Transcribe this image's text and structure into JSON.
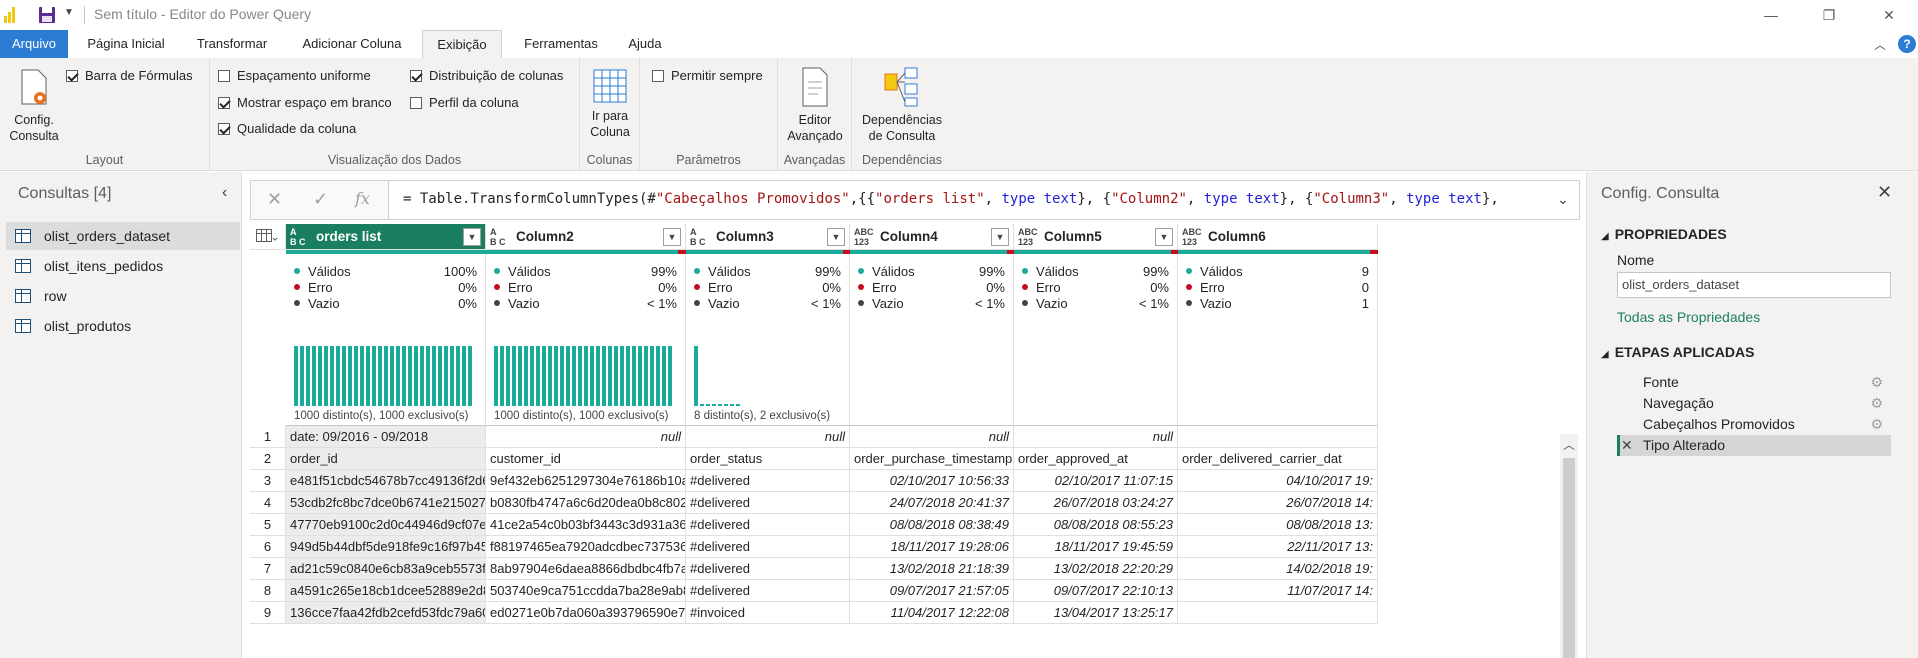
{
  "window": {
    "title": "Sem título - Editor do Power Query",
    "minimize_glyph": "—",
    "restore_glyph": "❐",
    "close_glyph": "✕"
  },
  "tabs": [
    "Arquivo",
    "Página Inicial",
    "Transformar",
    "Adicionar Coluna",
    "Exibição",
    "Ferramentas",
    "Ajuda"
  ],
  "ribbon": {
    "layout": {
      "config_label_1": "Config.",
      "config_label_2": "Consulta",
      "formula_bar": {
        "label": "Barra de Fórmulas",
        "checked": true
      },
      "group_label": "Layout"
    },
    "data_view": {
      "uniform_spacing": {
        "label": "Espaçamento uniforme",
        "checked": false
      },
      "show_whitespace": {
        "label": "Mostrar espaço em branco",
        "checked": true
      },
      "column_quality": {
        "label": "Qualidade da coluna",
        "checked": true
      },
      "column_distribution": {
        "label": "Distribuição de colunas",
        "checked": true
      },
      "column_profile": {
        "label": "Perfil da coluna",
        "checked": false
      },
      "group_label": "Visualização dos Dados"
    },
    "columns": {
      "btn_1": "Ir para",
      "btn_2": "Coluna",
      "group_label": "Colunas"
    },
    "parameters": {
      "always_allow": {
        "label": "Permitir sempre",
        "checked": false
      },
      "group_label": "Parâmetros"
    },
    "advanced": {
      "btn_1": "Editor",
      "btn_2": "Avançado",
      "group_label": "Avançadas"
    },
    "dependencies": {
      "btn_1": "Dependências",
      "btn_2": "de Consulta",
      "group_label": "Dependências"
    }
  },
  "queries": {
    "title": "Consultas [4]",
    "items": [
      "olist_orders_dataset",
      "olist_itens_pedidos",
      "row",
      "olist_produtos"
    ],
    "selected_index": 0
  },
  "formula_bar": {
    "cancel_glyph": "✕",
    "confirm_glyph": "✓",
    "fx_glyph": "fx",
    "p1": "= Table.TransformColumnTypes(#",
    "s1": "\"Cabeçalhos Promovidos\"",
    "p2": ",{{",
    "s2": "\"orders list\"",
    "p3": ", ",
    "k1": "type text",
    "p4": "}, {",
    "s3": "\"Column2\"",
    "p5": ", ",
    "k2": "type text",
    "p6": "}, {",
    "s4": "\"Column3\"",
    "p7": ", ",
    "k3": "type text",
    "p8": "},"
  },
  "grid": {
    "columns": [
      {
        "type_line1": "A",
        "type_line2": "B C",
        "name": "orders list",
        "selected": true,
        "valid": "100%",
        "error": "0%",
        "empty": "0%",
        "footer": "1000 distinto(s), 1000 exclusivo(s)",
        "red_fraction": 0
      },
      {
        "type_line1": "A",
        "type_line2": "B C",
        "name": "Column2",
        "selected": false,
        "valid": "99%",
        "error": "0%",
        "empty": "< 1%",
        "footer": "1000 distinto(s), 1000 exclusivo(s)",
        "red_fraction": 0.01
      },
      {
        "type_line1": "A",
        "type_line2": "B C",
        "name": "Column3",
        "selected": false,
        "valid": "99%",
        "error": "0%",
        "empty": "< 1%",
        "footer": "8 distinto(s), 2 exclusivo(s)",
        "red_fraction": 0.01
      },
      {
        "type_line1": "ABC",
        "type_line2": "123",
        "name": "Column4",
        "selected": false,
        "valid": "99%",
        "error": "0%",
        "empty": "< 1%",
        "footer": "",
        "red_fraction": 0.01
      },
      {
        "type_line1": "ABC",
        "type_line2": "123",
        "name": "Column5",
        "selected": false,
        "valid": "99%",
        "error": "0%",
        "empty": "< 1%",
        "footer": "",
        "red_fraction": 0.01
      },
      {
        "type_line1": "ABC",
        "type_line2": "123",
        "name": "Column6",
        "selected": false,
        "valid": "9",
        "error": "0",
        "empty": "1",
        "footer": "",
        "red_fraction": 0.01
      }
    ],
    "stat_labels": {
      "valid": "Válidos",
      "error": "Erro",
      "empty": "Vazio"
    },
    "rows": [
      {
        "n": "1",
        "cells": [
          "date: 09/2016 - 09/2018",
          "null",
          "null",
          "null",
          "null",
          ""
        ]
      },
      {
        "n": "2",
        "cells": [
          "order_id",
          "customer_id",
          "order_status",
          "order_purchase_timestamp",
          "order_approved_at",
          "order_delivered_carrier_dat"
        ]
      },
      {
        "n": "3",
        "cells": [
          "e481f51cbdc54678b7cc49136f2d6af7",
          "9ef432eb6251297304e76186b10a9...",
          "#delivered",
          "02/10/2017 10:56:33",
          "02/10/2017 11:07:15",
          "04/10/2017 19:"
        ]
      },
      {
        "n": "4",
        "cells": [
          "53cdb2fc8bc7dce0b6741e21502734...",
          "b0830fb4747a6c6d20dea0b8c802d7...",
          "#delivered",
          "24/07/2018 20:41:37",
          "26/07/2018 03:24:27",
          "26/07/2018 14:"
        ]
      },
      {
        "n": "5",
        "cells": [
          "47770eb9100c2d0c44946d9cf07ec6...",
          "41ce2a54c0b03bf3443c3d931a3670...",
          "#delivered",
          "08/08/2018 08:38:49",
          "08/08/2018 08:55:23",
          "08/08/2018 13:"
        ]
      },
      {
        "n": "6",
        "cells": [
          "949d5b44dbf5de918fe9c16f97b45f8a",
          "f88197465ea7920adcdbec7375364d...",
          "#delivered",
          "18/11/2017 19:28:06",
          "18/11/2017 19:45:59",
          "22/11/2017 13:"
        ]
      },
      {
        "n": "7",
        "cells": [
          "ad21c59c0840e6cb83a9ceb5573f8159",
          "8ab97904e6daea8866dbdbc4fb7aad...",
          "#delivered",
          "13/02/2018 21:18:39",
          "13/02/2018 22:20:29",
          "14/02/2018 19:"
        ]
      },
      {
        "n": "8",
        "cells": [
          "a4591c265e18cb1dcee52889e2d8ac...",
          "503740e9ca751ccdda7ba28e9ab8f6...",
          "#delivered",
          "09/07/2017 21:57:05",
          "09/07/2017 22:10:13",
          "11/07/2017 14:"
        ]
      },
      {
        "n": "9",
        "cells": [
          "136cce7faa42fdb2cefd53fdc79a6098",
          "ed0271e0b7da060a393796590e7b7...",
          "#invoiced",
          "11/04/2017 12:22:08",
          "13/04/2017 13:25:17",
          ""
        ]
      }
    ]
  },
  "settings": {
    "title": "Config. Consulta",
    "close_glyph": "✕",
    "properties_heading": "PROPRIEDADES",
    "name_label": "Nome",
    "name_value": "olist_orders_dataset",
    "all_properties_link": "Todas as Propriedades",
    "steps_heading": "ETAPAS APLICADAS",
    "steps": [
      {
        "label": "Fonte",
        "gear": true
      },
      {
        "label": "Navegação",
        "gear": true
      },
      {
        "label": "Cabeçalhos Promovidos",
        "gear": true
      },
      {
        "label": "Tipo Alterado",
        "gear": false,
        "selected": true
      }
    ]
  },
  "colors": {
    "accent": "#1a7f60",
    "file_tab": "#2b7cd3",
    "quality_valid": "#1aab9b",
    "quality_error": "#c50f1f",
    "dot_empty": "#444444"
  },
  "icons": {
    "app": "powerbi-logo-icon",
    "save": "save-icon",
    "config": "query-settings-icon",
    "goto_column": "go-to-column-icon",
    "advanced_editor": "advanced-editor-icon",
    "dependencies": "query-dependencies-icon",
    "collapse": "chevron-left-icon",
    "gear": "gear-icon",
    "table": "table-icon"
  }
}
